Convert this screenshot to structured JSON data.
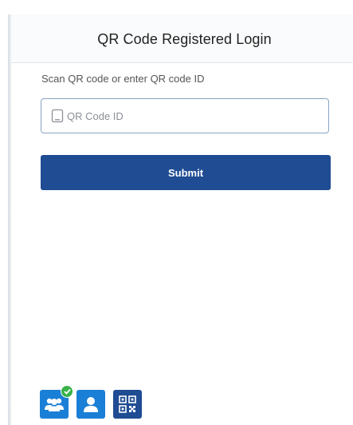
{
  "header": {
    "title": "QR Code Registered Login"
  },
  "form": {
    "instruction": "Scan QR code or enter QR code ID",
    "input_placeholder": "QR Code ID",
    "input_value": "",
    "input_icon": "mobile-phone-icon",
    "submit_label": "Submit"
  },
  "footer": {
    "tabs": [
      {
        "id": "group-login",
        "icon": "users-icon",
        "badge": "check-icon",
        "active": true
      },
      {
        "id": "user-login",
        "icon": "user-icon"
      },
      {
        "id": "qr-login",
        "icon": "qr-code-icon"
      }
    ]
  },
  "colors": {
    "primary": "#1f4c93",
    "tab_blue": "#1a7fd6",
    "success_badge": "#38b24a",
    "input_border": "#8aa3c4"
  }
}
